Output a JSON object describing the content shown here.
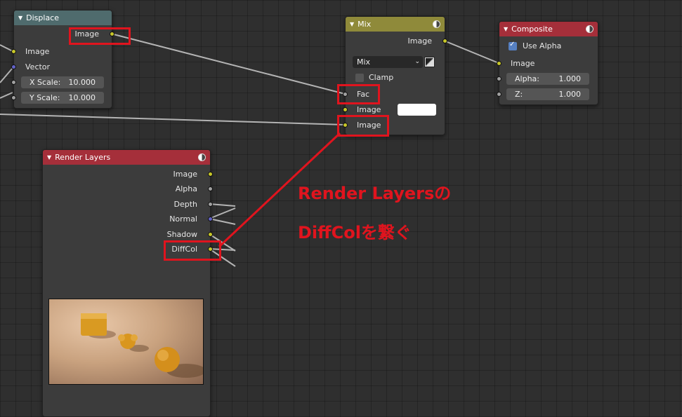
{
  "nodes": {
    "displace": {
      "title": "Displace",
      "outputs": [
        "Image"
      ],
      "inputs": [
        "Image",
        "Vector"
      ],
      "x_scale": {
        "label": "X Scale:",
        "value": "10.000"
      },
      "y_scale": {
        "label": "Y Scale:",
        "value": "10.000"
      }
    },
    "mix": {
      "title": "Mix",
      "output": "Image",
      "blend_mode": "Mix",
      "clamp_label": "Clamp",
      "inputs": [
        "Fac",
        "Image",
        "Image"
      ]
    },
    "composite": {
      "title": "Composite",
      "use_alpha_label": "Use Alpha",
      "input": "Image",
      "alpha": {
        "label": "Alpha:",
        "value": "1.000"
      },
      "z": {
        "label": "Z:",
        "value": "1.000"
      }
    },
    "render_layers": {
      "title": "Render Layers",
      "outputs": [
        "Image",
        "Alpha",
        "Depth",
        "Normal",
        "Shadow",
        "DiffCol"
      ]
    }
  },
  "annotation": {
    "line1": "Render Layersの",
    "line2": "DiffColを繋ぐ"
  },
  "colors": {
    "highlight": "#e0141e",
    "socket_color": "#c7c729",
    "socket_value": "#a1a1a1",
    "socket_vector": "#6363c7"
  }
}
